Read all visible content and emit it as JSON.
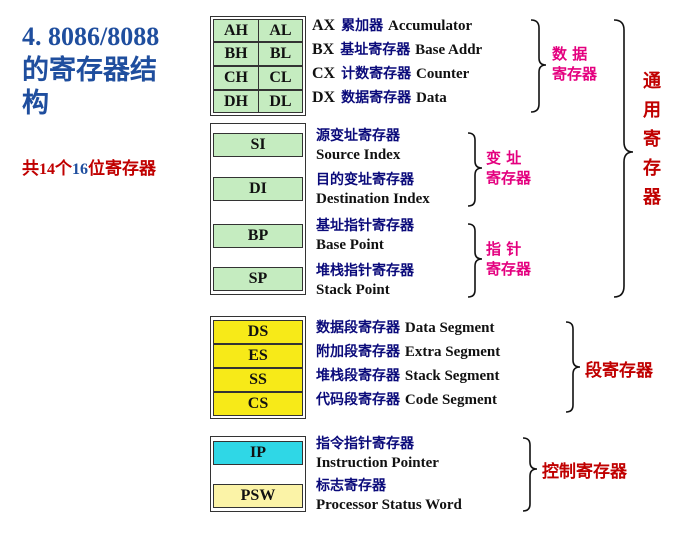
{
  "title": {
    "line1": "4. 8086/8088",
    "line2": "的寄存器结",
    "line3": "构"
  },
  "subtitle": {
    "p1": "共",
    "n1": "14",
    "p2": "个",
    "n2": "16",
    "p3": "位寄存器"
  },
  "data_regs": [
    {
      "hi": "AH",
      "lo": "AL",
      "name": "AX",
      "cn": "累加器",
      "en": "Accumulator"
    },
    {
      "hi": "BH",
      "lo": "BL",
      "name": "BX",
      "cn": "基址寄存器",
      "en": "Base Addr"
    },
    {
      "hi": "CH",
      "lo": "CL",
      "name": "CX",
      "cn": "计数寄存器",
      "en": "Counter"
    },
    {
      "hi": "DH",
      "lo": "DL",
      "name": "DX",
      "cn": "数据寄存器",
      "en": "Data"
    }
  ],
  "index_regs": [
    {
      "name": "SI",
      "cn": "源变址寄存器",
      "en": "Source Index"
    },
    {
      "name": "DI",
      "cn": "目的变址寄存器",
      "en": "Destination Index"
    }
  ],
  "pointer_regs": [
    {
      "name": "BP",
      "cn": "基址指针寄存器",
      "en": "Base Point"
    },
    {
      "name": "SP",
      "cn": "堆栈指针寄存器",
      "en": "Stack Point"
    }
  ],
  "segment_regs": [
    {
      "name": "DS",
      "cn": "数据段寄存器",
      "en": "Data Segment"
    },
    {
      "name": "ES",
      "cn": "附加段寄存器",
      "en": "Extra Segment"
    },
    {
      "name": "SS",
      "cn": "堆栈段寄存器",
      "en": "Stack Segment"
    },
    {
      "name": "CS",
      "cn": "代码段寄存器",
      "en": "Code Segment"
    }
  ],
  "control_regs": [
    {
      "name": "IP",
      "cn": "指令指针寄存器",
      "en": "Instruction Pointer"
    },
    {
      "name": "PSW",
      "cn": "标志寄存器",
      "en": "Processor Status Word"
    }
  ],
  "groups": {
    "data": {
      "l1": "数  据",
      "l2": "寄存器"
    },
    "index": {
      "l1": "变  址",
      "l2": "寄存器"
    },
    "pointer": {
      "l1": "指  针",
      "l2": "寄存器"
    },
    "general": [
      "通",
      "用",
      "寄",
      "存",
      "器"
    ],
    "segment": "段寄存器",
    "control": "控制寄存器"
  },
  "colors": {
    "title": "#1f4e9e",
    "accent_red": "#c00000",
    "group_magenta": "#e4007f",
    "label_blue": "#0a0a7a",
    "general_reg": "#c5ecc0",
    "segment_reg": "#f7ea18",
    "ip_reg": "#2fd7e6",
    "psw_reg": "#fbf3a7"
  }
}
